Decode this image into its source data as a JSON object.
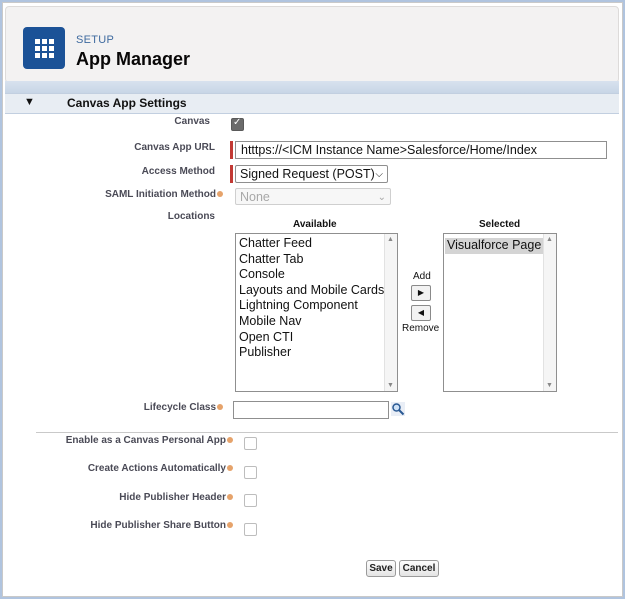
{
  "header": {
    "breadcrumb": "SETUP",
    "title": "App Manager"
  },
  "section": {
    "title": "Canvas App Settings"
  },
  "fields": {
    "canvas_label": "Canvas",
    "canvas_checked": true,
    "canvas_url_label": "Canvas App URL",
    "canvas_url_value": "htttps://<ICM Instance Name>Salesforce/Home/Index",
    "access_method_label": "Access Method",
    "access_method_value": "Signed Request (POST)",
    "saml_label": "SAML Initiation Method",
    "saml_value": "None",
    "locations_label": "Locations",
    "lifecycle_label": "Lifecycle Class",
    "lifecycle_value": ""
  },
  "locations": {
    "available_header": "Available",
    "selected_header": "Selected",
    "available": [
      "Chatter Feed",
      "Chatter Tab",
      "Console",
      "Layouts and Mobile Cards",
      "Lightning Component",
      "Mobile Nav",
      "Open CTI",
      "Publisher"
    ],
    "selected": [
      "Visualforce Page"
    ],
    "add_label": "Add",
    "remove_label": "Remove"
  },
  "options": [
    {
      "label": "Enable as a Canvas Personal App",
      "checked": false
    },
    {
      "label": "Create Actions Automatically",
      "checked": false
    },
    {
      "label": "Hide Publisher Header",
      "checked": false
    },
    {
      "label": "Hide Publisher Share Button",
      "checked": false
    }
  ],
  "buttons": {
    "save": "Save",
    "cancel": "Cancel"
  },
  "colors": {
    "required": "#c23934",
    "app_icon": "#1b5297",
    "help": "#e6a36b"
  },
  "icons": {
    "app": "grid-icon",
    "lookup": "magnifier-icon",
    "add": "arrow-right-icon",
    "remove": "arrow-left-icon",
    "collapse": "triangle-down-icon"
  }
}
